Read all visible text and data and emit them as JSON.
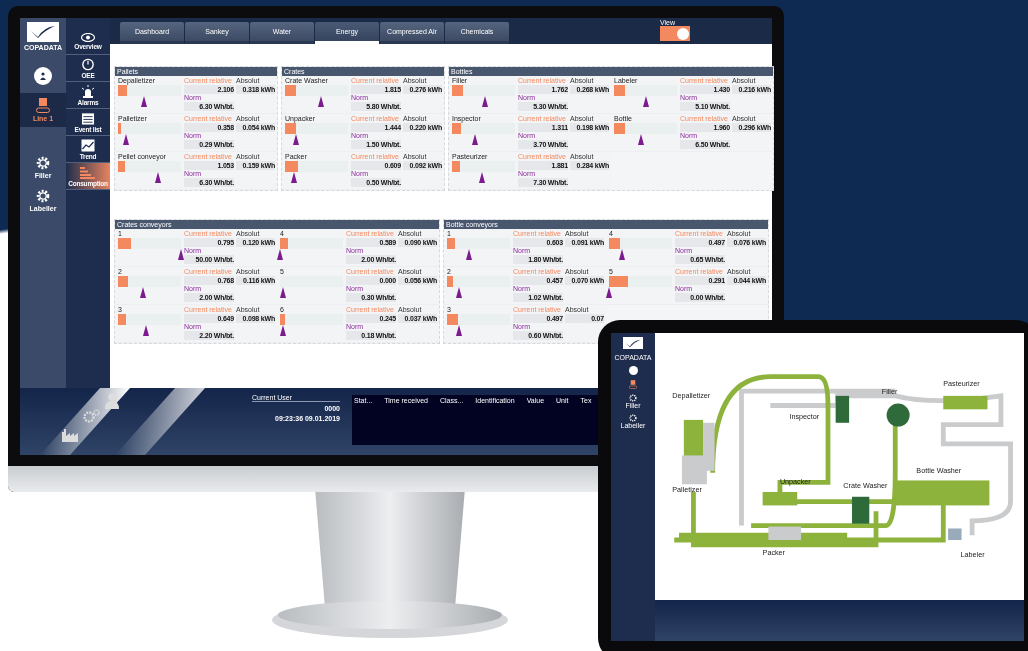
{
  "monitor": {
    "logo": "COPADATA",
    "line_nav": [
      {
        "label": "Line 1",
        "kind": "line",
        "selected": true
      },
      {
        "label": "Filler",
        "kind": "machine",
        "selected": false
      },
      {
        "label": "Labeller",
        "kind": "machine",
        "selected": false
      }
    ],
    "screen_nav": [
      {
        "label": "Overview",
        "kind": "eye",
        "selected": false
      },
      {
        "label": "OEE",
        "kind": "gauge",
        "selected": false
      },
      {
        "label": "Alarms",
        "kind": "beacon",
        "selected": false
      },
      {
        "label": "Event list",
        "kind": "list",
        "selected": false
      },
      {
        "label": "Trend",
        "kind": "trend",
        "selected": false
      },
      {
        "label": "Consumption",
        "kind": "bars",
        "selected": true
      }
    ],
    "tabs": [
      {
        "label": "Dashboard",
        "selected": false
      },
      {
        "label": "Sankey",
        "selected": false
      },
      {
        "label": "Water",
        "selected": false
      },
      {
        "label": "Energy",
        "selected": true
      },
      {
        "label": "Compressed Air",
        "selected": false
      },
      {
        "label": "Chemicals",
        "selected": false
      }
    ],
    "view": {
      "label": "View",
      "on": true
    },
    "panel_rows": [
      {
        "panels": [
          {
            "title": "Pallets",
            "columns": [
              {
                "items": [
                  {
                    "name": "Depalletizer",
                    "level": 0.145,
                    "norm_marker": {
                      "level": 0.42
                    },
                    "current_relative_label": "Current relative",
                    "current_relative": "2.106",
                    "absolut_label": "Absolut",
                    "absolut": "0.318 kWh",
                    "norm_label": "Norm",
                    "norm": "6.30 Wh/bt."
                  },
                  {
                    "name": "Palletizer",
                    "level": 0.04,
                    "norm_marker": {
                      "level": 0.13
                    },
                    "current_relative_label": "Current relative",
                    "current_relative": "0.358",
                    "absolut_label": "Absolut",
                    "absolut": "0.054 kWh",
                    "norm_label": "Norm",
                    "norm": "0.29 Wh/bt."
                  },
                  {
                    "name": "Pellet conveyor",
                    "level": 0.11,
                    "norm_marker": {
                      "level": 0.63
                    },
                    "current_relative_label": "Current relative",
                    "current_relative": "1.053",
                    "absolut_label": "Absolut",
                    "absolut": "0.159 kWh",
                    "norm_label": "Norm",
                    "norm": "6.30 Wh/bt."
                  }
                ]
              }
            ]
          },
          {
            "title": "Crates",
            "columns": [
              {
                "items": [
                  {
                    "name": "Crate Washer",
                    "level": 0.18,
                    "norm_marker": {
                      "level": 0.57
                    },
                    "current_relative_label": "Current relative",
                    "current_relative": "1.815",
                    "absolut_label": "Absolut",
                    "absolut": "0.276 kWh",
                    "norm_label": "Norm",
                    "norm": "5.80 Wh/bt."
                  },
                  {
                    "name": "Unpacker",
                    "level": 0.18,
                    "norm_marker": {
                      "level": 0.17
                    },
                    "current_relative_label": "Current relative",
                    "current_relative": "1.444",
                    "absolut_label": "Absolut",
                    "absolut": "0.220 kWh",
                    "norm_label": "Norm",
                    "norm": "1.50 Wh/bt."
                  },
                  {
                    "name": "Packer",
                    "level": 0.21,
                    "norm_marker": {
                      "level": 0.15
                    },
                    "current_relative_label": "Current relative",
                    "current_relative": "0.609",
                    "absolut_label": "Absolut",
                    "absolut": "0.092 kWh",
                    "norm_label": "Norm",
                    "norm": "0.50 Wh/bt."
                  }
                ]
              }
            ]
          },
          {
            "title": "Bottles",
            "columns": [
              {
                "items": [
                  {
                    "name": "Filler",
                    "level": 0.18,
                    "norm_marker": {
                      "level": 0.53
                    },
                    "current_relative_label": "Current relative",
                    "current_relative": "1.762",
                    "absolut_label": "Absolut",
                    "absolut": "0.268 kWh",
                    "norm_label": "Norm",
                    "norm": "5.30 Wh/bt."
                  },
                  {
                    "name": "Inspector",
                    "level": 0.14,
                    "norm_marker": {
                      "level": 0.37
                    },
                    "current_relative_label": "Current relative",
                    "current_relative": "1.311",
                    "absolut_label": "Absolut",
                    "absolut": "0.198 kWh",
                    "norm_label": "Norm",
                    "norm": "3.70 Wh/bt."
                  },
                  {
                    "name": "Pasteurizer",
                    "level": 0.13,
                    "norm_marker": {
                      "level": 0.48
                    },
                    "current_relative_label": "Current relative",
                    "current_relative": "1.881",
                    "absolut_label": "Absolut",
                    "absolut": "0.284 kWh",
                    "norm_label": "Norm",
                    "norm": "7.30 Wh/bt."
                  }
                ]
              },
              {
                "items": [
                  {
                    "name": "Labeler",
                    "level": 0.17,
                    "norm_marker": {
                      "level": 0.51
                    },
                    "current_relative_label": "Current relative",
                    "current_relative": "1.430",
                    "absolut_label": "Absolut",
                    "absolut": "0.216 kWh",
                    "norm_label": "Norm",
                    "norm": "5.10 Wh/bt."
                  },
                  {
                    "name": "Bottle",
                    "level": 0.17,
                    "norm_marker": {
                      "level": 0.43
                    },
                    "current_relative_label": "Current relative",
                    "current_relative": "1.960",
                    "absolut_label": "Absolut",
                    "absolut": "0.296 kWh",
                    "norm_label": "Norm",
                    "norm": "6.50 Wh/bt."
                  }
                ]
              }
            ]
          }
        ]
      },
      {
        "panels": [
          {
            "title": "Crates conveyors",
            "columns": [
              {
                "items": [
                  {
                    "name": "1",
                    "level": 0.2,
                    "norm_marker": {
                      "level": 1.0
                    },
                    "current_relative_label": "Current relative",
                    "current_relative": "0.795",
                    "absolut_label": "Absolut",
                    "absolut": "0.120 kWh",
                    "norm_label": "Norm",
                    "norm": "50.00 Wh/bt."
                  },
                  {
                    "name": "2",
                    "level": 0.16,
                    "norm_marker": {
                      "level": 0.39
                    },
                    "current_relative_label": "Current relative",
                    "current_relative": "0.768",
                    "absolut_label": "Absolut",
                    "absolut": "0.116 kWh",
                    "norm_label": "Norm",
                    "norm": "2.00 Wh/bt."
                  },
                  {
                    "name": "3",
                    "level": 0.13,
                    "norm_marker": {
                      "level": 0.44
                    },
                    "current_relative_label": "Current relative",
                    "current_relative": "0.649",
                    "absolut_label": "Absolut",
                    "absolut": "0.098 kWh",
                    "norm_label": "Norm",
                    "norm": "2.20 Wh/bt."
                  }
                ]
              },
              {
                "items": [
                  {
                    "name": "4",
                    "level": 0.12,
                    "norm_marker": {
                      "level": 0.0
                    },
                    "current_relative_label": "Current relative",
                    "current_relative": "0.589",
                    "absolut_label": "Absolut",
                    "absolut": "0.090 kWh",
                    "norm_label": "Norm",
                    "norm": "2.00 Wh/bt."
                  },
                  {
                    "name": "5",
                    "level": 0.0,
                    "norm_marker": {
                      "level": 0.05
                    },
                    "current_relative_label": "Current relative",
                    "current_relative": "0.000",
                    "absolut_label": "Absolut",
                    "absolut": "0.056 kWh",
                    "norm_label": "Norm",
                    "norm": "0.30 Wh/bt."
                  },
                  {
                    "name": "6",
                    "level": 0.08,
                    "norm_marker": {
                      "level": 0.05
                    },
                    "current_relative_label": "Current relative",
                    "current_relative": "0.245",
                    "absolut_label": "Absolut",
                    "absolut": "0.037 kWh",
                    "norm_label": "Norm",
                    "norm": "0.18 Wh/bt."
                  }
                ]
              }
            ]
          },
          {
            "title": "Bottle conveyors",
            "columns": [
              {
                "items": [
                  {
                    "name": "1",
                    "level": 0.13,
                    "norm_marker": {
                      "level": 0.35
                    },
                    "current_relative_label": "Current relative",
                    "current_relative": "0.603",
                    "absolut_label": "Absolut",
                    "absolut": "0.091 kWh",
                    "norm_label": "Norm",
                    "norm": "1.80 Wh/bt."
                  },
                  {
                    "name": "2",
                    "level": 0.1,
                    "norm_marker": {
                      "level": 0.19
                    },
                    "current_relative_label": "Current relative",
                    "current_relative": "0.457",
                    "absolut_label": "Absolut",
                    "absolut": "0.070 kWh",
                    "norm_label": "Norm",
                    "norm": "1.02 Wh/bt."
                  },
                  {
                    "name": "3",
                    "level": 0.17,
                    "norm_marker": {
                      "level": 0.19
                    },
                    "current_relative_label": "Current relative",
                    "current_relative": "0.497",
                    "absolut_label": "Absolut",
                    "absolut": "0.07",
                    "norm_label": "Norm",
                    "norm": "0.60 Wh/bt."
                  }
                ]
              },
              {
                "items": [
                  {
                    "name": "4",
                    "level": 0.17,
                    "norm_marker": {
                      "level": 0.21
                    },
                    "current_relative_label": "Current relative",
                    "current_relative": "0.497",
                    "absolut_label": "Absolut",
                    "absolut": "0.076 kWh",
                    "norm_label": "Norm",
                    "norm": "0.65 Wh/bt."
                  },
                  {
                    "name": "5",
                    "level": 0.3,
                    "norm_marker": {
                      "level": 0.0
                    },
                    "current_relative_label": "Current relative",
                    "current_relative": "0.291",
                    "absolut_label": "Absolut",
                    "absolut": "0.044 kWh",
                    "norm_label": "Norm",
                    "norm": "0.00 Wh/bt."
                  }
                ]
              }
            ]
          }
        ]
      }
    ],
    "status": {
      "user_label": "Current User",
      "user": "0000",
      "datetime": "09:23:36 09.01.2019"
    },
    "alarm_list": {
      "columns": [
        "Stat...",
        "Time received",
        "Class...",
        "Identification",
        "Value",
        "Unit",
        "Tex"
      ]
    }
  },
  "tablet": {
    "logo": "COPADATA",
    "nav": [
      {
        "label": "Filler"
      },
      {
        "label": "Labeller"
      }
    ],
    "machines": [
      {
        "label": "Depalletizer"
      },
      {
        "label": "Palletizer"
      },
      {
        "label": "Inspector"
      },
      {
        "label": "Filler"
      },
      {
        "label": "Pasteurizer"
      },
      {
        "label": "Bottle Washer"
      },
      {
        "label": "Crate Washer"
      },
      {
        "label": "Unpacker"
      },
      {
        "label": "Packer"
      },
      {
        "label": "Labeler"
      }
    ]
  }
}
